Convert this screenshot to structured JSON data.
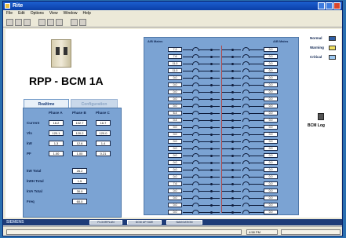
{
  "window": {
    "title": "Rite"
  },
  "menu": [
    "File",
    "Edit",
    "Options",
    "View",
    "Window",
    "Help"
  ],
  "unit": {
    "title": "RPP - BCM 1A"
  },
  "tabs": {
    "realtime": "Realtime",
    "other": "Configuration"
  },
  "left_panel": {
    "phase_headers": [
      "Phase A",
      "Phase B",
      "Phase C"
    ],
    "rows": [
      {
        "label": "Current",
        "values": [
          "16.2",
          "102.7",
          "16.7"
        ]
      },
      {
        "label": "Vln",
        "values": [
          "120.1",
          "120.2",
          "120.0"
        ]
      },
      {
        "label": "kW",
        "values": [
          "1.3",
          "12.6",
          "1.4"
        ]
      },
      {
        "label": "PF",
        "values": [
          "1.00",
          "1.00",
          "0.21"
        ]
      }
    ],
    "totals": [
      {
        "label": "kW Total",
        "value": "26.2"
      },
      {
        "label": "kWH Total",
        "value": "1.5"
      },
      {
        "label": "kVA Total",
        "value": "30.0"
      },
      {
        "label": "Freq",
        "value": "60.0"
      }
    ]
  },
  "right_panel": {
    "left_bus": "A/B Mains",
    "right_bus": "A/B Mains",
    "feeds": [
      {
        "left": "7.2",
        "right": "0.0"
      },
      {
        "left": "7.6",
        "right": "0.0"
      },
      {
        "left": "11.0",
        "right": "0.0"
      },
      {
        "left": "11.0",
        "right": "0.0"
      },
      {
        "left": "0.0",
        "right": "0.0"
      },
      {
        "left": "0.0",
        "right": "0.0"
      },
      {
        "left": "0.0",
        "right": "0.0"
      },
      {
        "left": "0.0",
        "right": "0.0"
      },
      {
        "left": "0.0",
        "right": "0.0"
      },
      {
        "left": "6.4",
        "right": "0.0"
      },
      {
        "left": "0.4",
        "right": "0.0"
      },
      {
        "left": "0.0",
        "right": "0.0"
      },
      {
        "left": "0.0",
        "right": "0.0"
      },
      {
        "left": "0.0",
        "right": "0.0"
      },
      {
        "left": "0.0",
        "right": "0.0"
      },
      {
        "left": "0.0",
        "right": "0.0"
      },
      {
        "left": "0.0",
        "right": "0.0"
      },
      {
        "left": "0.0",
        "right": "0.0"
      },
      {
        "left": "0.0",
        "right": "0.0"
      },
      {
        "left": "7.6",
        "right": "0.0"
      },
      {
        "left": "0.0",
        "right": "0.0"
      },
      {
        "left": "0.0",
        "right": "0.0"
      },
      {
        "left": "0.0",
        "right": "0.0"
      },
      {
        "left": "0.0",
        "right": "0.0"
      }
    ]
  },
  "legend": [
    {
      "label": "Normal",
      "color": "#2f5fa8"
    },
    {
      "label": "Warning",
      "color": "#f0e060"
    },
    {
      "label": "Critical",
      "color": "#9cc8f0"
    }
  ],
  "bcm_log": "BCM Log",
  "statusbar": {
    "brand": "SIEMENS",
    "buttons": [
      "FLOORPLAN",
      "DCM UP SIZE",
      "NAVIGATION"
    ]
  },
  "bottombar": {
    "field1": "",
    "field2": "4:58 PM"
  }
}
